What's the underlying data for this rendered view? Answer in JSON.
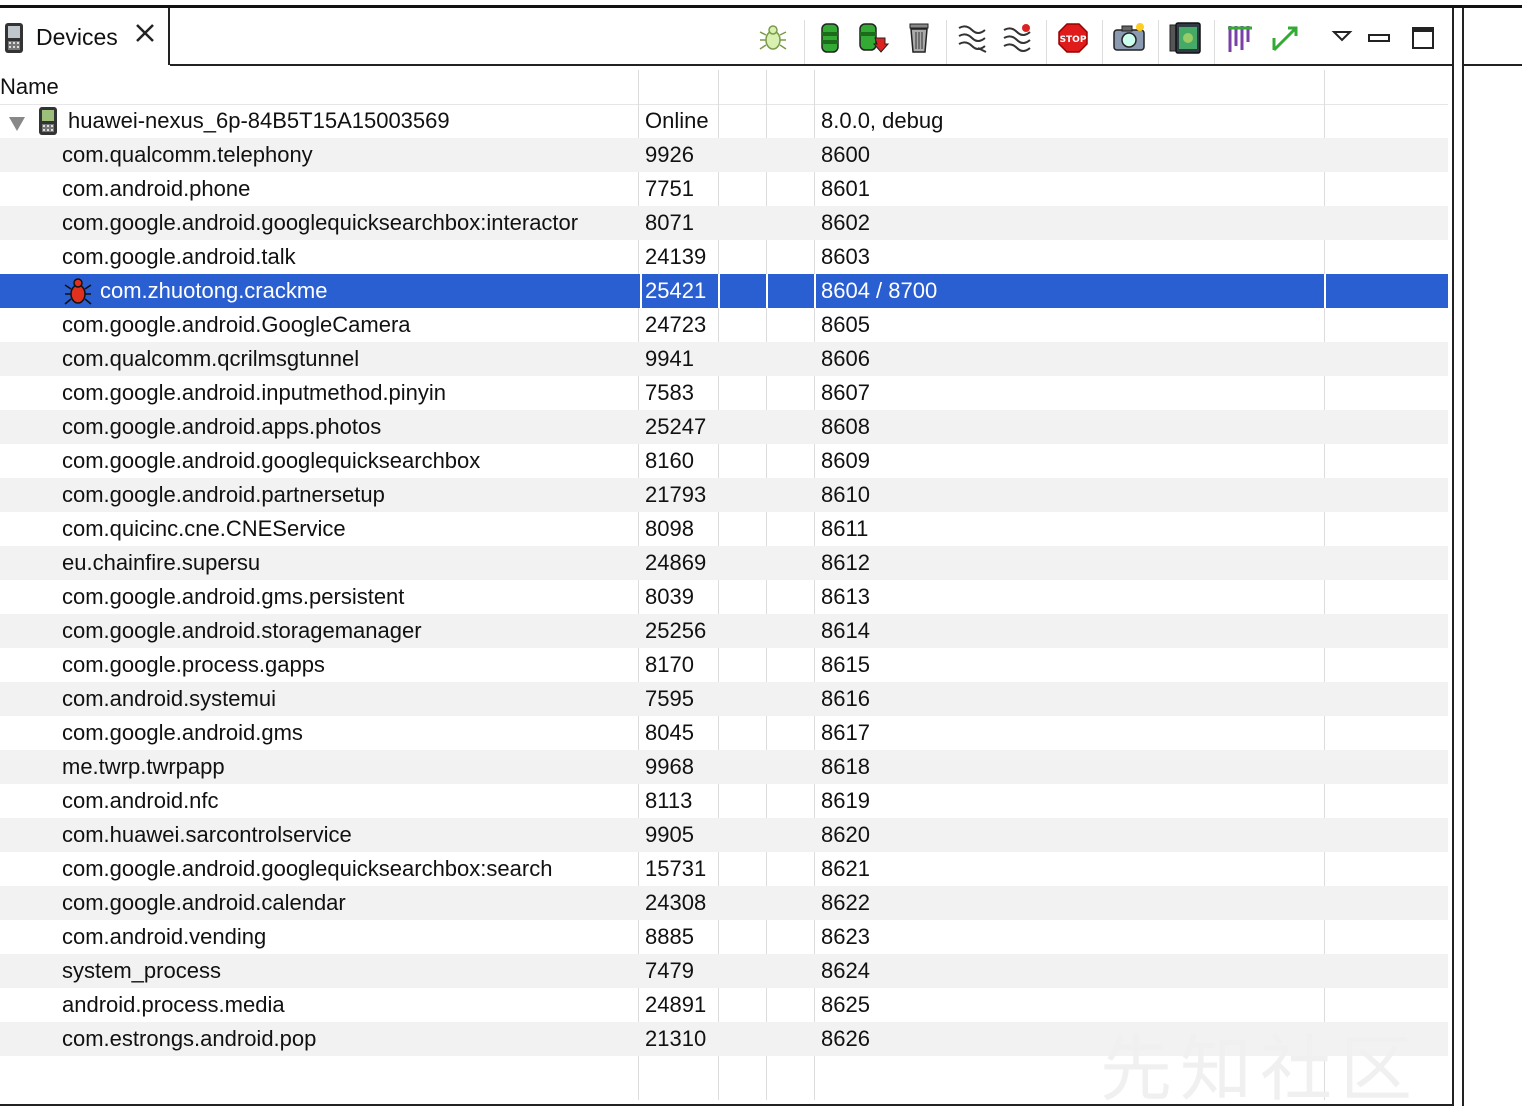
{
  "tab": {
    "title": "Devices"
  },
  "header": {
    "name_col": "Name"
  },
  "device": {
    "name": "huawei-nexus_6p-84B5T15A15003569",
    "state": "Online",
    "version": "8.0.0, debug"
  },
  "processes": [
    {
      "name": "com.qualcomm.telephony",
      "pid": "9926",
      "port": "8600"
    },
    {
      "name": "com.android.phone",
      "pid": "7751",
      "port": "8601"
    },
    {
      "name": "com.google.android.googlequicksearchbox:interactor",
      "pid": "8071",
      "port": "8602"
    },
    {
      "name": "com.google.android.talk",
      "pid": "24139",
      "port": "8603"
    },
    {
      "name": "com.zhuotong.crackme",
      "pid": "25421",
      "port": "8604 / 8700"
    },
    {
      "name": "com.google.android.GoogleCamera",
      "pid": "24723",
      "port": "8605"
    },
    {
      "name": "com.qualcomm.qcrilmsgtunnel",
      "pid": "9941",
      "port": "8606"
    },
    {
      "name": "com.google.android.inputmethod.pinyin",
      "pid": "7583",
      "port": "8607"
    },
    {
      "name": "com.google.android.apps.photos",
      "pid": "25247",
      "port": "8608"
    },
    {
      "name": "com.google.android.googlequicksearchbox",
      "pid": "8160",
      "port": "8609"
    },
    {
      "name": "com.google.android.partnersetup",
      "pid": "21793",
      "port": "8610"
    },
    {
      "name": "com.quicinc.cne.CNEService",
      "pid": "8098",
      "port": "8611"
    },
    {
      "name": "eu.chainfire.supersu",
      "pid": "24869",
      "port": "8612"
    },
    {
      "name": "com.google.android.gms.persistent",
      "pid": "8039",
      "port": "8613"
    },
    {
      "name": "com.google.android.storagemanager",
      "pid": "25256",
      "port": "8614"
    },
    {
      "name": "com.google.process.gapps",
      "pid": "8170",
      "port": "8615"
    },
    {
      "name": "com.android.systemui",
      "pid": "7595",
      "port": "8616"
    },
    {
      "name": "com.google.android.gms",
      "pid": "8045",
      "port": "8617"
    },
    {
      "name": "me.twrp.twrpapp",
      "pid": "9968",
      "port": "8618"
    },
    {
      "name": "com.android.nfc",
      "pid": "8113",
      "port": "8619"
    },
    {
      "name": "com.huawei.sarcontrolservice",
      "pid": "9905",
      "port": "8620"
    },
    {
      "name": "com.google.android.googlequicksearchbox:search",
      "pid": "15731",
      "port": "8621"
    },
    {
      "name": "com.google.android.calendar",
      "pid": "24308",
      "port": "8622"
    },
    {
      "name": "com.android.vending",
      "pid": "8885",
      "port": "8623"
    },
    {
      "name": "system_process",
      "pid": "7479",
      "port": "8624"
    },
    {
      "name": "android.process.media",
      "pid": "24891",
      "port": "8625"
    },
    {
      "name": "com.estrongs.android.pop",
      "pid": "21310",
      "port": "8626"
    }
  ],
  "selected_index": 4,
  "watermark": "先知社区",
  "toolbar": [
    "debug-process-icon",
    "update-heap-icon",
    "dump-hprof-icon",
    "cause-gc-icon",
    "update-threads-icon",
    "start-method-profiling-icon",
    "stop-process-icon",
    "screen-capture-icon",
    "dump-view-hierarchy-icon",
    "systrace-icon",
    "opengl-trace-icon"
  ],
  "colors": {
    "selection": "#2a5fd1",
    "alt_row": "#f2f2f2"
  }
}
